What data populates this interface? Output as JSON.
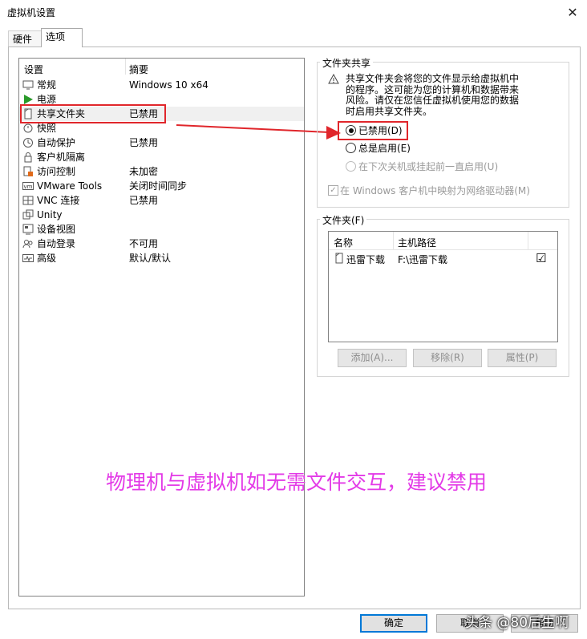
{
  "window": {
    "title": "虚拟机设置",
    "close_glyph": "✕"
  },
  "tabs": [
    {
      "label": "硬件"
    },
    {
      "label": "选项"
    }
  ],
  "settings_list": {
    "col_settings": "设置",
    "col_summary": "摘要",
    "items": [
      {
        "name": "常规",
        "summary": "Windows 10 x64",
        "icon": "monitor-icon"
      },
      {
        "name": "电源",
        "summary": "",
        "icon": "play-icon"
      },
      {
        "name": "共享文件夹",
        "summary": "已禁用",
        "icon": "shared-folder-icon"
      },
      {
        "name": "快照",
        "summary": "",
        "icon": "snapshot-icon"
      },
      {
        "name": "自动保护",
        "summary": "已禁用",
        "icon": "clock-icon"
      },
      {
        "name": "客户机隔离",
        "summary": "",
        "icon": "lock-icon"
      },
      {
        "name": "访问控制",
        "summary": "未加密",
        "icon": "access-control-icon"
      },
      {
        "name": "VMware Tools",
        "summary": "关闭时间同步",
        "icon": "vmware-icon"
      },
      {
        "name": "VNC 连接",
        "summary": "已禁用",
        "icon": "vnc-icon"
      },
      {
        "name": "Unity",
        "summary": "",
        "icon": "unity-icon"
      },
      {
        "name": "设备视图",
        "summary": "",
        "icon": "device-view-icon"
      },
      {
        "name": "自动登录",
        "summary": "不可用",
        "icon": "users-icon"
      },
      {
        "name": "高级",
        "summary": "默认/默认",
        "icon": "advanced-icon"
      }
    ]
  },
  "folder_sharing": {
    "group_label": "文件夹共享",
    "warning_lines": [
      "共享文件夹会将您的文件显示给虚拟机中",
      "的程序。这可能为您的计算机和数据带来",
      "风险。请仅在您信任虚拟机使用您的数据",
      "时启用共享文件夹。"
    ],
    "options": [
      {
        "label": "已禁用(D)",
        "selected": true,
        "enabled": true
      },
      {
        "label": "总是启用(E)",
        "selected": false,
        "enabled": true
      },
      {
        "label": "在下次关机或挂起前一直启用(U)",
        "selected": false,
        "enabled": false
      }
    ],
    "map_drive_label": "在 Windows 客户机中映射为网络驱动器(M)"
  },
  "folders": {
    "group_label": "文件夹(F)",
    "col_name": "名称",
    "col_path": "主机路径",
    "rows": [
      {
        "name": "迅雷下载",
        "path": "F:\\迅雷下载",
        "checked": "☑"
      }
    ],
    "add_button": "添加(A)...",
    "remove_button": "移除(R)",
    "properties_button": "属性(P)"
  },
  "footer": {
    "ok_button": "确定",
    "cancel_button": "取消",
    "help_button": "帮助"
  },
  "overlay_text": "物理机与虚拟机如无需文件交互，建议禁用",
  "watermark": "头条 @80后生啊",
  "colors": {
    "highlight_red": "#e0262b",
    "overlay_magenta": "#e33ae7"
  }
}
